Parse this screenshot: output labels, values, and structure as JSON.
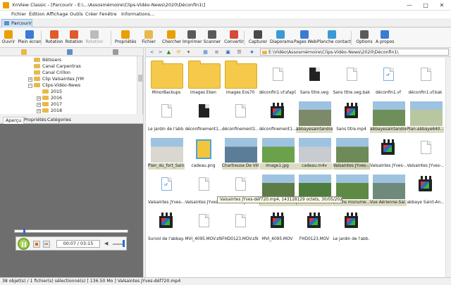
{
  "window": {
    "title": "XnView Classic - [Parcourir - E:\\...\\Assosmémoire\\Clips-Vidéo-News\\2020\\Déconfin1\\]",
    "controls": [
      "—",
      "□",
      "✕"
    ]
  },
  "menu": [
    "Fichier",
    "Édition",
    "Affichage",
    "Outils",
    "Créer",
    "Fenêtre",
    "Informations..."
  ],
  "tab": {
    "label": "Parcourir"
  },
  "toolbar": [
    {
      "label": "Ouvrir",
      "icon": "folder-open-icon",
      "color": "#e8a000"
    },
    {
      "label": "Plein écran",
      "icon": "fullscreen-icon",
      "color": "#3a7bd5"
    },
    {
      "label": "Rotation",
      "icon": "rotate-left-icon",
      "color": "#e05a2a"
    },
    {
      "label": "Rotation",
      "icon": "rotate-right-icon",
      "color": "#e05a2a"
    },
    {
      "label": "Rotation",
      "icon": "rotate-disabled-icon",
      "color": "#bbbbbb"
    },
    {
      "label": "Propriétés",
      "icon": "properties-icon",
      "color": "#e8a000"
    },
    {
      "label": "Fichier",
      "icon": "file-icon",
      "color": "#e8b84a"
    },
    {
      "label": "Chercher",
      "icon": "search-icon",
      "color": "#e8a000"
    },
    {
      "label": "Imprimer",
      "icon": "printer-icon",
      "color": "#5a5a5a"
    },
    {
      "label": "Scanner",
      "icon": "scanner-icon",
      "color": "#5a5a5a"
    },
    {
      "label": "Convertir",
      "icon": "convert-icon",
      "color": "#d54a3a"
    },
    {
      "label": "Capturer",
      "icon": "camera-icon",
      "color": "#4a4a4a"
    },
    {
      "label": "Diaporama",
      "icon": "slideshow-icon",
      "color": "#3a9ad5"
    },
    {
      "label": "Pages Web",
      "icon": "web-pages-icon",
      "color": "#3a7bd5"
    },
    {
      "label": "Planche contact",
      "icon": "contact-sheet-icon",
      "color": "#3a9ad5"
    },
    {
      "label": "Options",
      "icon": "options-icon",
      "color": "#5a5a5a"
    },
    {
      "label": "A propos",
      "icon": "about-icon",
      "color": "#3a7bd5"
    }
  ],
  "tree": [
    {
      "label": "Bêtisiers",
      "level": 0,
      "expand": ""
    },
    {
      "label": "Canal Carpentras",
      "level": 0,
      "expand": ""
    },
    {
      "label": "Canal Crillon",
      "level": 0,
      "expand": ""
    },
    {
      "label": "Clip Valsaintes JYM",
      "level": 0,
      "expand": "+"
    },
    {
      "label": "Clips-Vidéo-News",
      "level": 0,
      "expand": "−"
    },
    {
      "label": "2015",
      "level": 1,
      "expand": ""
    },
    {
      "label": "2016",
      "level": 1,
      "expand": "+"
    },
    {
      "label": "2017",
      "level": 1,
      "expand": "+"
    },
    {
      "label": "2018",
      "level": 1,
      "expand": "+"
    }
  ],
  "subtabs": [
    "Aperçu",
    "Propriétés",
    "Catégories"
  ],
  "player": {
    "timecode": "00:07 / 03:15"
  },
  "address": "E:\\Vidéo\\Assosmémoire\\Clips-Vidéo-News\\2020\\Déconfin1\\",
  "files": [
    {
      "name": "MinorBackups",
      "kind": "folder"
    },
    {
      "name": "images Eken",
      "kind": "folder"
    },
    {
      "name": "images Eos70",
      "kind": "folder"
    },
    {
      "name": "déconfin1.vf.sfap0",
      "kind": "doc"
    },
    {
      "name": "Sans titre.veg",
      "kind": "veg"
    },
    {
      "name": "Sans titre.veg.bak",
      "kind": "doc"
    },
    {
      "name": "déconfin1.vf",
      "kind": "vf"
    },
    {
      "name": "déconfin1.vf.bak",
      "kind": "doc"
    },
    {
      "name": "Le jardin de l'abb...",
      "kind": "doc"
    },
    {
      "name": "déconfinement1....",
      "kind": "veg"
    },
    {
      "name": "déconfinement1....",
      "kind": "doc"
    },
    {
      "name": "déconfinement1....",
      "kind": "video"
    },
    {
      "name": "abbayesaintandre...",
      "kind": "photo",
      "color": "#7c8a6a"
    },
    {
      "name": "Sans titre.mp4",
      "kind": "video"
    },
    {
      "name": "abbayesaintandre...",
      "kind": "photo",
      "color": "#6f8f5a"
    },
    {
      "name": "Plan-abbaye640...",
      "kind": "photo",
      "color": "#b9c7a0"
    },
    {
      "name": "Plan_du_fort_Sain...",
      "kind": "photo",
      "color": "#d8d8d0"
    },
    {
      "name": "cadeau.png",
      "kind": "gift"
    },
    {
      "name": "Chartreuse De Vill...",
      "kind": "photo",
      "color": "#5c7d98"
    },
    {
      "name": "Image1.jpg",
      "kind": "photo",
      "color": "#6aa14a"
    },
    {
      "name": "cadeau.m4v",
      "kind": "photo",
      "color": "#c8ccd0"
    },
    {
      "name": "Valsaintes JYves-...",
      "kind": "photo",
      "color": "#6e8a56"
    },
    {
      "name": "Valsaintes JYves-...",
      "kind": "video"
    },
    {
      "name": "Valsaintes JYves-...",
      "kind": "doc"
    },
    {
      "name": "Valsaintes JYves-...",
      "kind": "vf"
    },
    {
      "name": "Valsaintes JYves-...",
      "kind": "doc"
    },
    {
      "name": "Valsaintes JYves-...",
      "kind": "doc"
    },
    {
      "name": "Jardins monume...",
      "kind": "photo",
      "color": "#5d7c46"
    },
    {
      "name": "Jardins monume...",
      "kind": "photo",
      "color": "#4f7d3e"
    },
    {
      "name": "Jardins monume...",
      "kind": "photo",
      "color": "#5e8a45"
    },
    {
      "name": "Vue Aérienne-Sai...",
      "kind": "photo",
      "color": "#6f8a7a"
    },
    {
      "name": "abbaye Saint-An...",
      "kind": "video"
    },
    {
      "name": "Survol de l'abbay...",
      "kind": "video"
    },
    {
      "name": "MVI_4095.MOV.sfk",
      "kind": "doc"
    },
    {
      "name": "FHD0123.MOV.sfk",
      "kind": "doc"
    },
    {
      "name": "MVI_4095.MOV",
      "kind": "video"
    },
    {
      "name": "FHD0123.MOV",
      "kind": "video"
    },
    {
      "name": "Le jardin de l'abb...",
      "kind": "video"
    }
  ],
  "tooltip": "Valsaintes JYves-déf720.mp4, 143128129 octets, 30/05/2020 14:57",
  "status": "38 objet(s) / 1 fichier(s) sélectionné(s)  [ 136.50 Mo ]   Valsaintes JYves-déf720.mp4"
}
